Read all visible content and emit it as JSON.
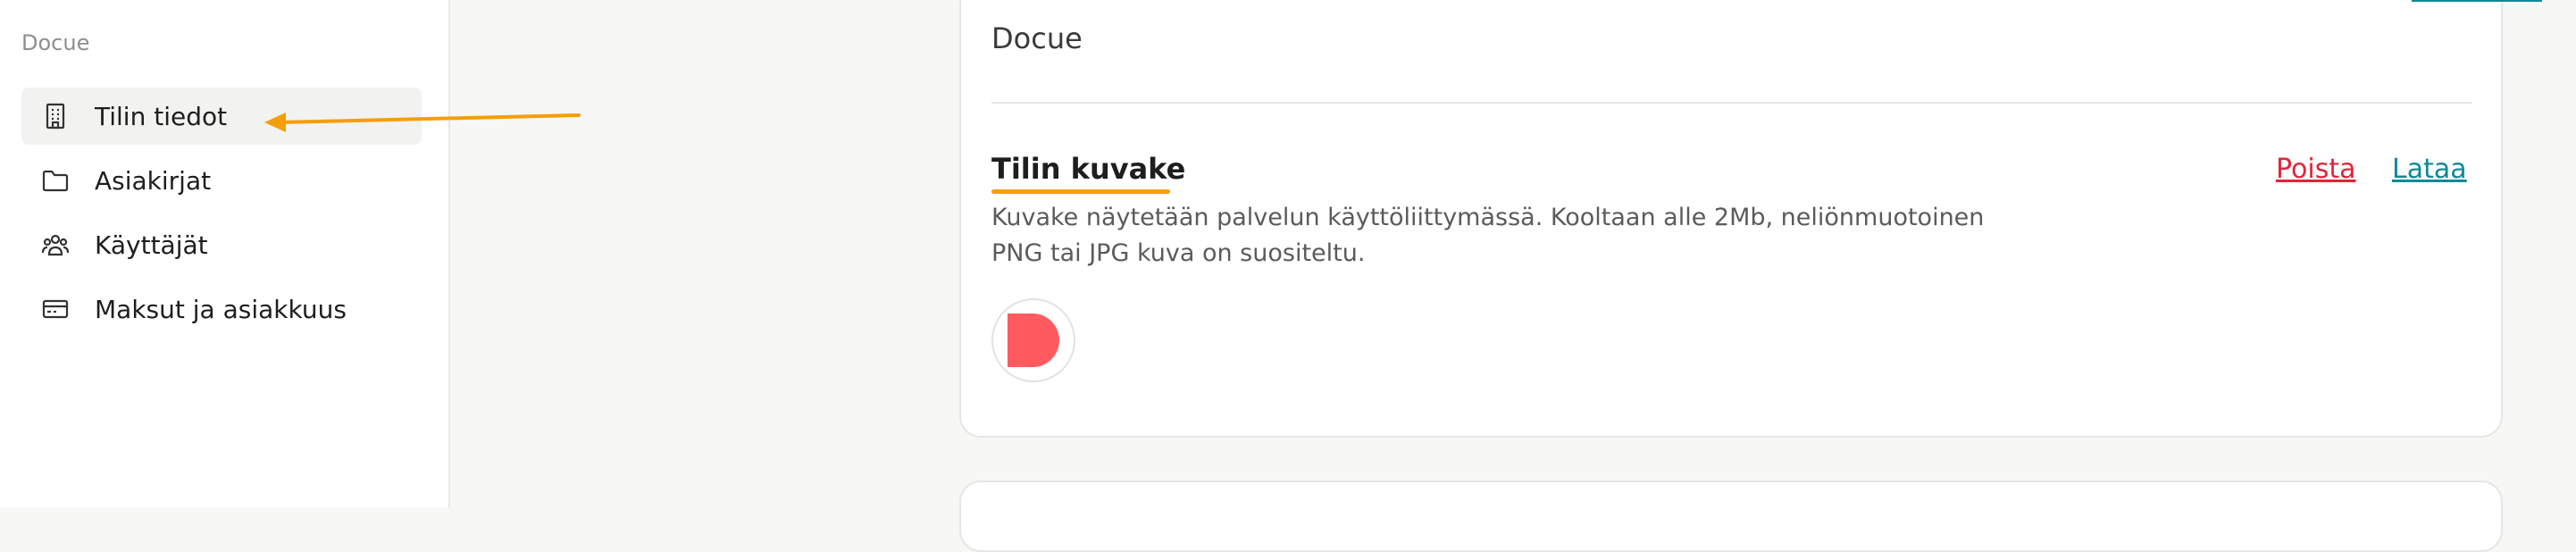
{
  "sidebar": {
    "header": "Docue",
    "items": [
      {
        "label": "Tilin tiedot",
        "icon": "building-icon",
        "active": true
      },
      {
        "label": "Asiakirjat",
        "icon": "folder-icon",
        "active": false
      },
      {
        "label": "Käyttäjät",
        "icon": "users-icon",
        "active": false
      },
      {
        "label": "Maksut ja asiakkuus",
        "icon": "credit-card-icon",
        "active": false
      }
    ]
  },
  "main": {
    "org_name": "Docue",
    "section": {
      "title": "Tilin kuvake",
      "description": "Kuvake näytetään palvelun käyttöliittymässä. Kooltaan alle 2Mb, neliönmuotoinen PNG tai JPG kuva on suositeltu.",
      "remove_label": "Poista",
      "upload_label": "Lataa"
    }
  },
  "colors": {
    "accent": "#0e8a96",
    "danger": "#e0243a",
    "highlight": "#f59e0b",
    "logo": "#ff5a5f"
  }
}
